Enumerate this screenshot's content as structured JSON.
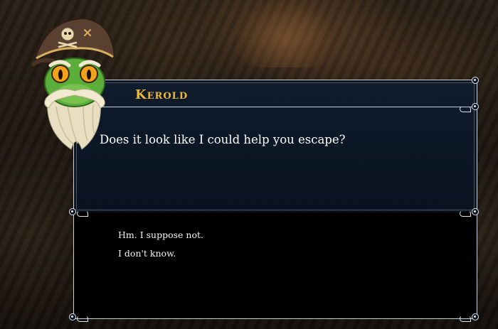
{
  "dialog": {
    "speaker_name": "Kerold",
    "speech": "Does it look like I could help you escape?"
  },
  "responses": [
    {
      "label": "Hm. I suppose not."
    },
    {
      "label": "I don't know."
    }
  ],
  "colors": {
    "name": "#f0b830",
    "frame": "#c9d2dc",
    "speech_bg": "#0e1c2e"
  },
  "icons": {
    "portrait": "kerold-portrait-icon"
  }
}
